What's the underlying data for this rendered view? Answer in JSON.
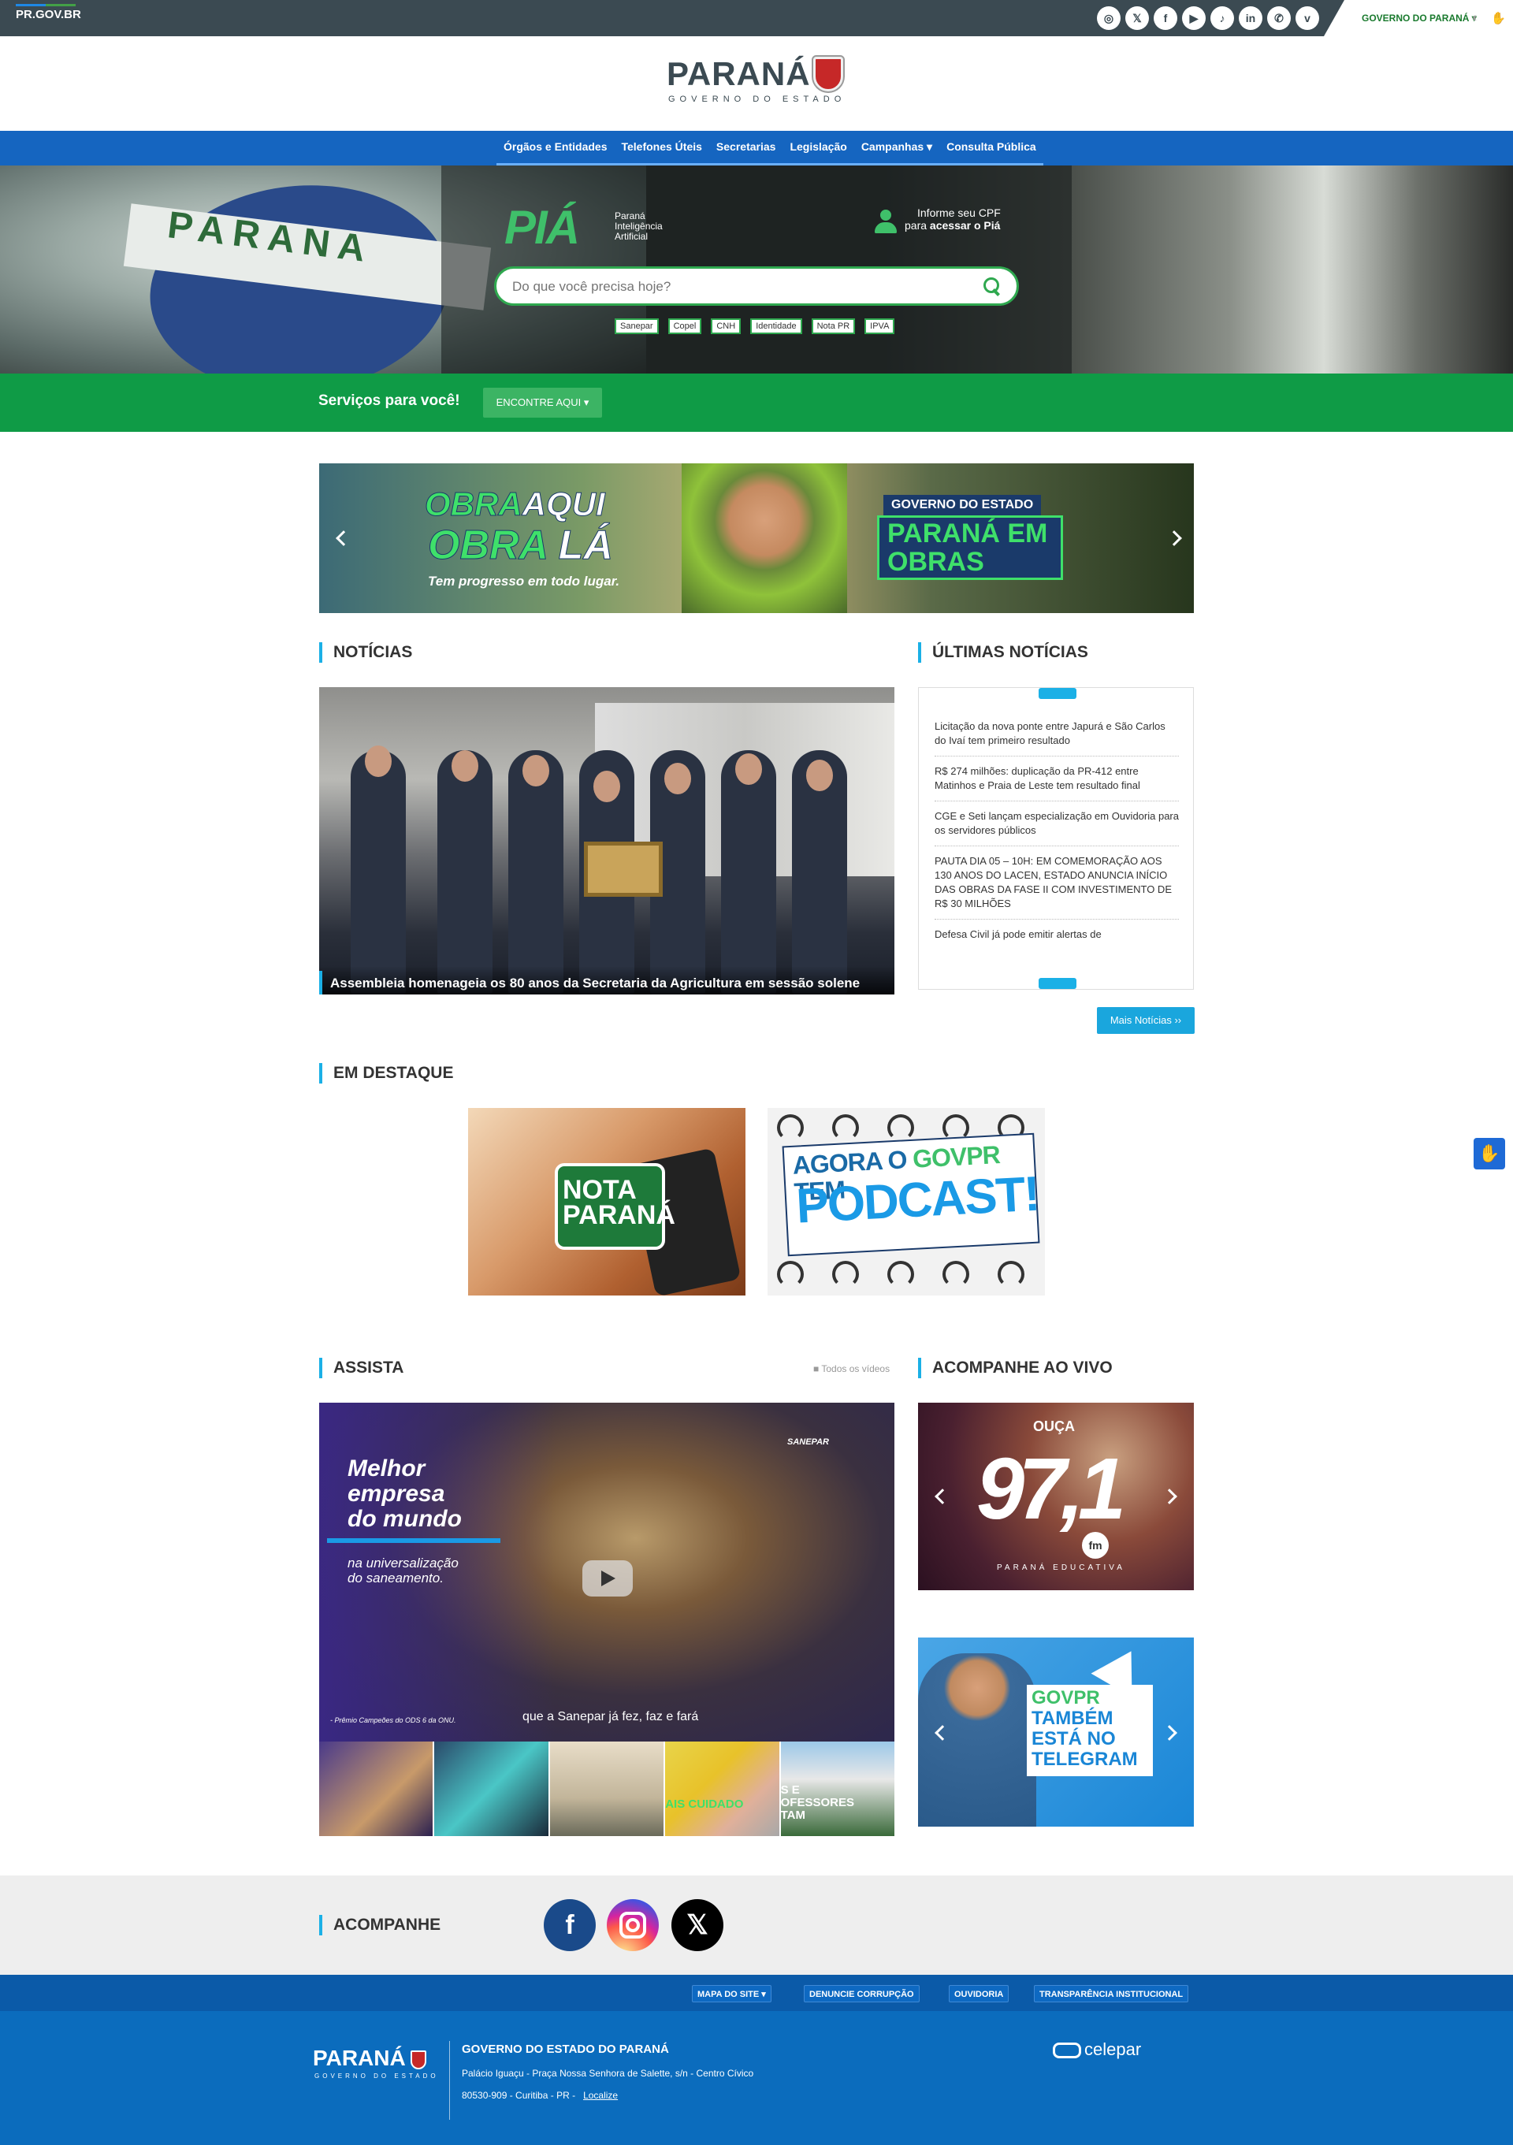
{
  "topbar": {
    "brand": "PR.GOV.BR",
    "social_icons": [
      "instagram-icon",
      "x-icon",
      "facebook-icon",
      "youtube-icon",
      "tiktok-icon",
      "linkedin-icon",
      "whatsapp-icon",
      "vimeo-icon"
    ],
    "governo_menu": "GOVERNO DO PARANÁ ▾"
  },
  "header": {
    "logo_word": "PARANÁ",
    "logo_sub": "GOVERNO DO ESTADO"
  },
  "nav": {
    "items": [
      "Órgãos e Entidades",
      "Telefones Úteis",
      "Secretarias",
      "Legislação",
      "Campanhas ▾",
      "Consulta Pública"
    ]
  },
  "hero": {
    "flag_text": "PARANA",
    "pia_logo": "PIÁ",
    "pia_tagline_1": "Paraná",
    "pia_tagline_2": "Inteligência",
    "pia_tagline_3": "Artificial",
    "cpf_line1": "Informe seu CPF",
    "cpf_line2_prefix": "para ",
    "cpf_line2_bold": "acessar o Piá",
    "search_placeholder": "Do que você precisa hoje?",
    "chips": [
      "Sanepar",
      "Copel",
      "CNH",
      "Identidade",
      "Nota PR",
      "IPVA"
    ]
  },
  "services": {
    "title": "Serviços para você!",
    "button": "ENCONTRE AQUI ▾"
  },
  "banner": {
    "line1_green": "OBRA",
    "line1_white": "AQUI",
    "line2_green": "OBRA",
    "line2_white": "LÁ",
    "line3": "Tem progresso em todo lugar.",
    "gov": "GOVERNO DO ESTADO",
    "title": "PARANÁ EM OBRAS"
  },
  "noticias": {
    "section_title": "NOTÍCIAS",
    "caption": "Assembleia homenageia os 80 anos da Secretaria da Agricultura em sessão solene"
  },
  "ultimas": {
    "section_title": "ÚLTIMAS NOTÍCIAS",
    "items": [
      "Licitação da nova ponte entre Japurá e São Carlos do Ivaí tem primeiro resultado",
      "R$ 274 milhões: duplicação da PR-412 entre Matinhos e Praia de Leste tem resultado final",
      "CGE e Seti lançam especialização em Ouvidoria para os servidores públicos",
      "PAUTA DIA 05 – 10H: EM COMEMORAÇÃO AOS 130 ANOS DO LACEN, ESTADO ANUNCIA INÍCIO DAS OBRAS DA FASE II COM INVESTIMENTO DE R$ 30 MILHÕES",
      "Defesa Civil já pode emitir alertas de"
    ],
    "more_button": "Mais Notícias ››"
  },
  "destaque": {
    "section_title": "EM DESTAQUE",
    "card1_text": "NOTA PARANÁ",
    "card2_line1": "AGORA O",
    "card2_green": "GOVPR",
    "card2_line1_end": "TEM",
    "card2_big": "PODCAST!"
  },
  "assista": {
    "section_title": "ASSISTA",
    "todos": "Todos os vídeos",
    "video_headline_1": "Melhor",
    "video_headline_2": "empresa",
    "video_headline_3": "do mundo",
    "video_sub_1": "na universalização",
    "video_sub_2": "do saneamento.",
    "subtitle": "que a Sanepar já fez, faz e fará",
    "brand": "SANEPAR",
    "ods": "- Prêmio Campeões do ODS 6 da ONU.",
    "thumb_texts": [
      "",
      "",
      "",
      "AIS CUIDADO",
      "S E\nOFESSORES\nTAM"
    ]
  },
  "aovivo": {
    "section_title": "ACOMPANHE AO VIVO",
    "radio_ouca": "OUÇA",
    "radio_number": "97,1",
    "radio_fm": "fm",
    "radio_name": "PARANÁ EDUCATIVA",
    "telegram_1": "GOVPR",
    "telegram_2": "TAMBÉM",
    "telegram_3": "ESTÁ NO",
    "telegram_4": "TELEGRAM"
  },
  "acompanhe": {
    "section_title": "ACOMPANHE"
  },
  "footer": {
    "links": [
      "MAPA DO SITE ▾",
      "DENUNCIE CORRUPÇÃO",
      "OUVIDORIA",
      "TRANSPARÊNCIA INSTITUCIONAL"
    ],
    "logo_word": "PARANÁ",
    "logo_sub": "GOVERNO DO ESTADO",
    "title": "GOVERNO DO ESTADO DO PARANÁ",
    "address": "Palácio Iguaçu - Praça Nossa Senhora de Salette, s/n - Centro Cívico",
    "city": "80530-909 - Curitiba - PR -",
    "localize": "Localize",
    "celepar": "celepar"
  }
}
